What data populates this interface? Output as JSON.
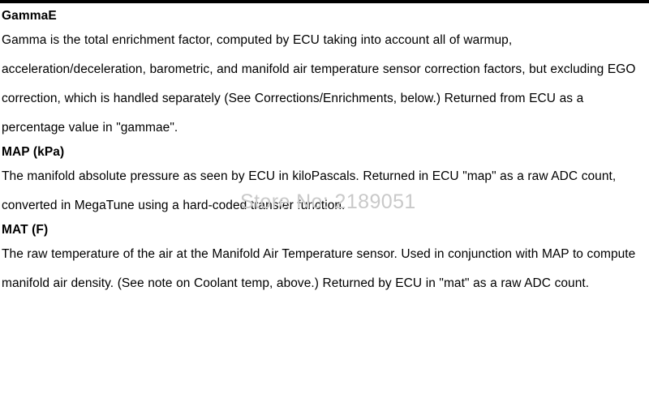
{
  "page": {
    "background_color": "#ffffff",
    "text_color": "#000000",
    "top_rule_color": "#000000"
  },
  "watermark": {
    "text": "Store No: 2189051",
    "color": "#c9c9c9"
  },
  "sections": [
    {
      "heading": "GammaE",
      "body": "Gamma is the total enrichment factor, computed by ECU taking into account all of warmup, acceleration/deceleration, barometric, and manifold air temperature sensor correction factors, but excluding EGO correction, which is handled separately (See Corrections/Enrichments, below.) Returned from ECU as a percentage value in \"gammae\"."
    },
    {
      "heading": "MAP (kPa)",
      "body": "The manifold absolute pressure as seen by ECU in kiloPascals. Returned in ECU \"map\" as a raw ADC count, converted in MegaTune using a hard-coded transfer function."
    },
    {
      "heading": "MAT (F)",
      "body": "The raw temperature of the air at the Manifold Air Temperature sensor. Used in conjunction with MAP to compute manifold air density. (See note on Coolant temp, above.) Returned by ECU in \"mat\" as a raw ADC count."
    }
  ]
}
